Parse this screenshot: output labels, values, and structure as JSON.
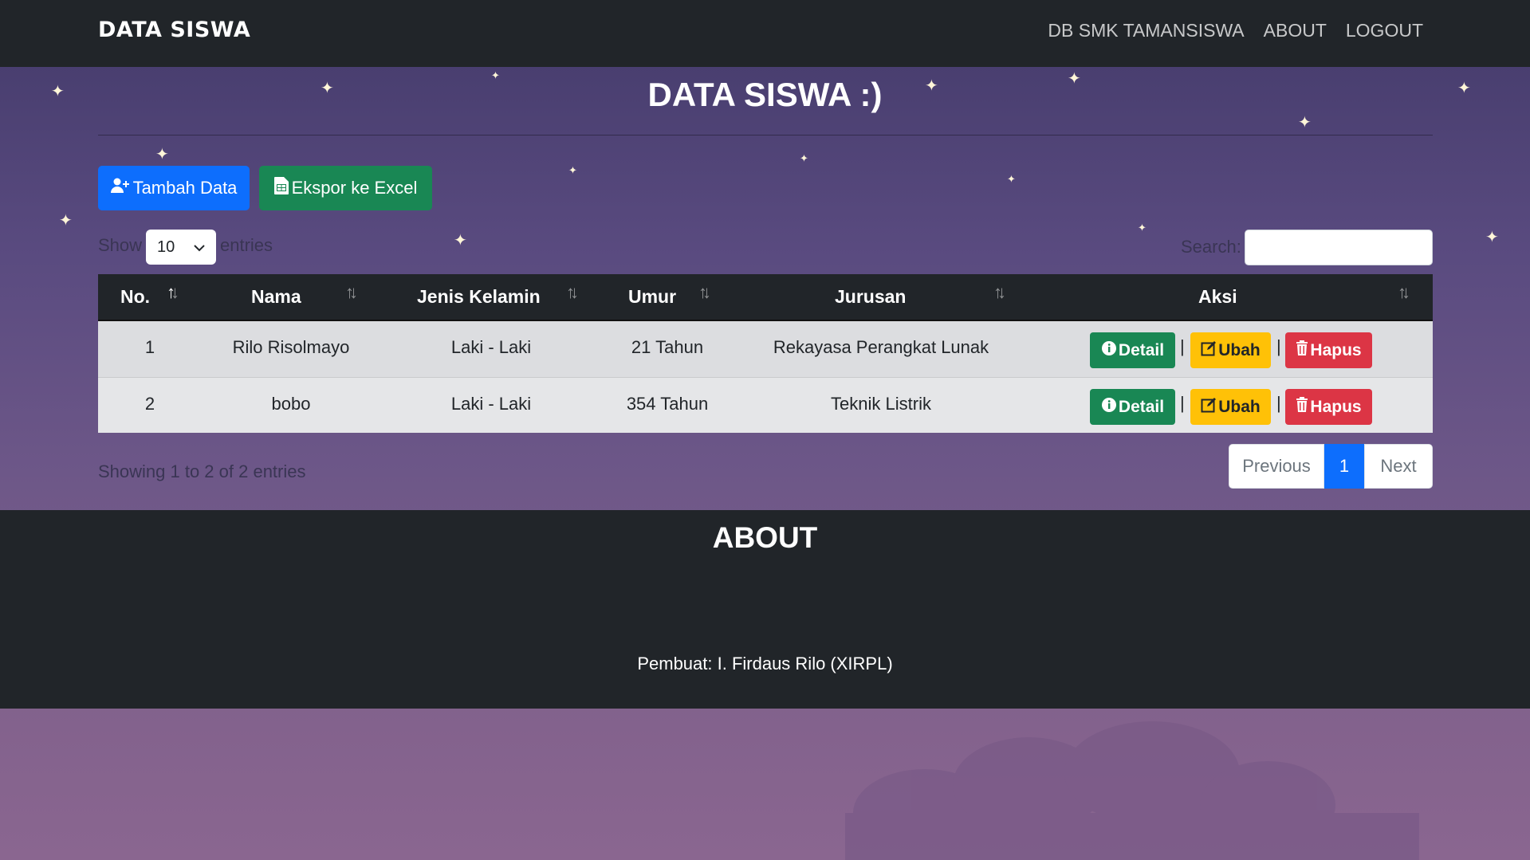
{
  "navbar": {
    "brand": "DATA SISWA",
    "links": [
      "DB SMK TAMANSISWA",
      "ABOUT",
      "LOGOUT"
    ]
  },
  "main": {
    "title": "DATA SISWA :)",
    "add_button": "Tambah Data",
    "export_button": "Ekspor ke Excel",
    "show_label": "Show",
    "entries_label": "entries",
    "page_length": "10",
    "search_label": "Search:",
    "search_value": ""
  },
  "table": {
    "columns": [
      "No.",
      "Nama",
      "Jenis Kelamin",
      "Umur",
      "Jurusan",
      "Aksi"
    ],
    "rows": [
      {
        "no": "1",
        "nama": "Rilo Risolmayo",
        "jk": "Laki - Laki",
        "umur": "21 Tahun",
        "jurusan": "Rekayasa Perangkat Lunak"
      },
      {
        "no": "2",
        "nama": "bobo",
        "jk": "Laki - Laki",
        "umur": "354 Tahun",
        "jurusan": "Teknik Listrik"
      }
    ],
    "actions": {
      "detail": "Detail",
      "ubah": "Ubah",
      "hapus": "Hapus",
      "separator": "|"
    }
  },
  "footer_table": {
    "info": "Showing 1 to 2 of 2 entries",
    "previous": "Previous",
    "current_page": "1",
    "next": "Next"
  },
  "about": {
    "title": "ABOUT",
    "credit": "Pembuat: I. Firdaus Rilo (XIRPL)"
  },
  "colors": {
    "navbar": "#212529",
    "primary": "#0d6efd",
    "success": "#198754",
    "warning": "#ffc107",
    "danger": "#dc3545"
  }
}
